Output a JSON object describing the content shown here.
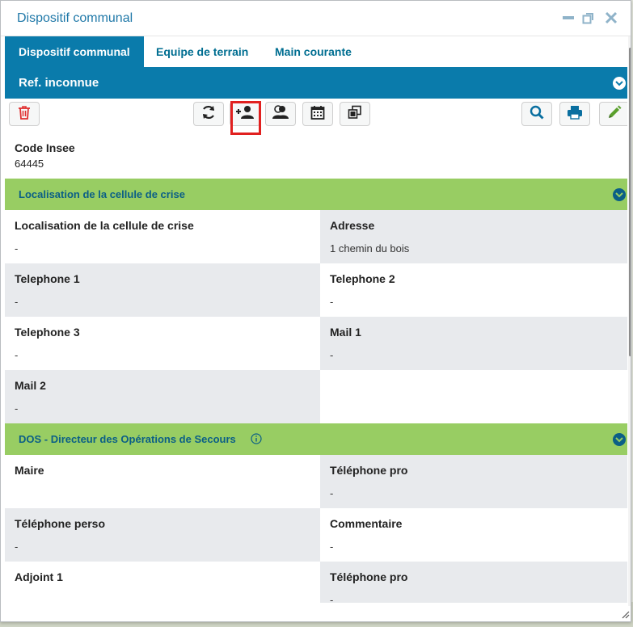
{
  "window": {
    "title": "Dispositif communal",
    "controls": [
      "minimize-icon",
      "restore-icon",
      "close-icon"
    ]
  },
  "tabs": [
    {
      "label": "Dispositif communal",
      "active": true
    },
    {
      "label": "Equipe de terrain",
      "active": false
    },
    {
      "label": "Main courante",
      "active": false
    }
  ],
  "record": {
    "header": "Ref. inconnue"
  },
  "toolbar": {
    "buttons": [
      "trash-icon",
      "refresh-icon",
      "add-user-icon",
      "users-icon",
      "calendar-icon",
      "copy-icon",
      "search-icon",
      "print-icon",
      "edit-icon"
    ]
  },
  "code_insee": {
    "label": "Code Insee",
    "value": "64445"
  },
  "sections": {
    "cellule": {
      "title": "Localisation de la cellule de crise",
      "fields": [
        {
          "label": "Localisation de la cellule de crise",
          "value": "-"
        },
        {
          "label": "Adresse",
          "value": "1 chemin du bois"
        },
        {
          "label": "Telephone 1",
          "value": "-"
        },
        {
          "label": "Telephone 2",
          "value": "-"
        },
        {
          "label": "Telephone 3",
          "value": "-"
        },
        {
          "label": "Mail 1",
          "value": "-"
        },
        {
          "label": "Mail 2",
          "value": "-"
        }
      ]
    },
    "dos": {
      "title": "DOS - Directeur des Opérations de Secours",
      "fields": [
        {
          "label": "Maire",
          "value": ""
        },
        {
          "label": "Téléphone pro",
          "value": "-"
        },
        {
          "label": "Téléphone perso",
          "value": "-"
        },
        {
          "label": "Commentaire",
          "value": "-"
        },
        {
          "label": "Adjoint 1",
          "value": ""
        },
        {
          "label": "Téléphone pro",
          "value": "-"
        }
      ]
    }
  },
  "colors": {
    "primary": "#0a7bab",
    "section": "#98cd63",
    "danger": "#e1201f",
    "edit": "#5aa02c"
  }
}
